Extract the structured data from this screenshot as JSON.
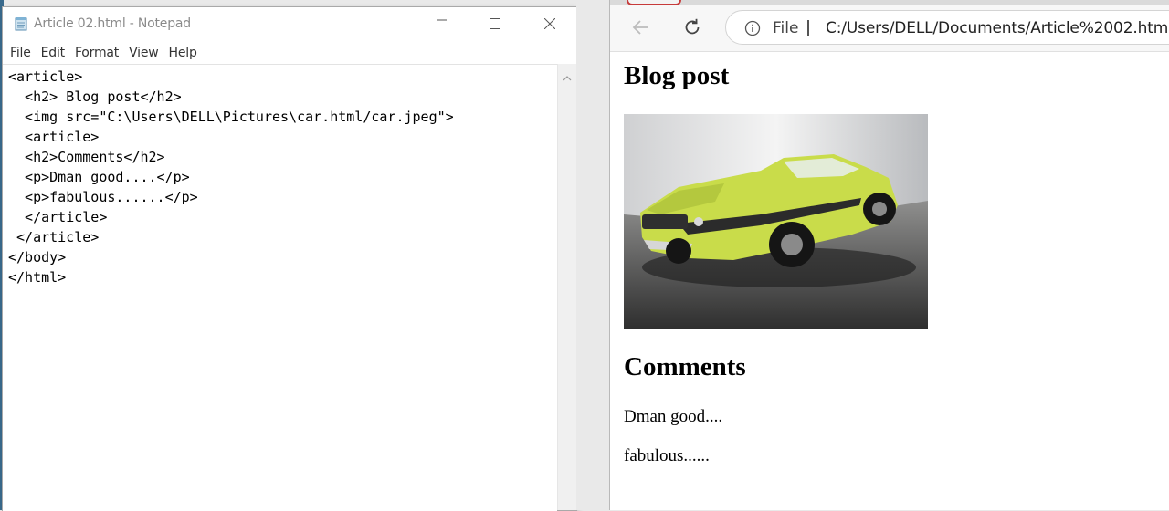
{
  "notepad": {
    "title": "Article 02.html - Notepad",
    "menu": [
      "File",
      "Edit",
      "Format",
      "View",
      "Help"
    ],
    "code": "<article>\n  <h2> Blog post</h2>\n  <img src=\"C:\\Users\\DELL\\Pictures\\car.html/car.jpeg\">\n  <article>\n  <h2>Comments</h2>\n  <p>Dman good....</p>\n  <p>fabulous......</p>\n  </article>\n </article>\n</body>\n</html>"
  },
  "browser": {
    "file_label": "File",
    "url": "C:/Users/DELL/Documents/Article%2002.html",
    "page": {
      "heading": "Blog post",
      "comments_heading": "Comments",
      "comments": [
        "Dman good....",
        "fabulous......"
      ]
    }
  },
  "colors": {
    "car_body": "#c9dc4a",
    "close_tab_accent": "#c73a3a"
  }
}
